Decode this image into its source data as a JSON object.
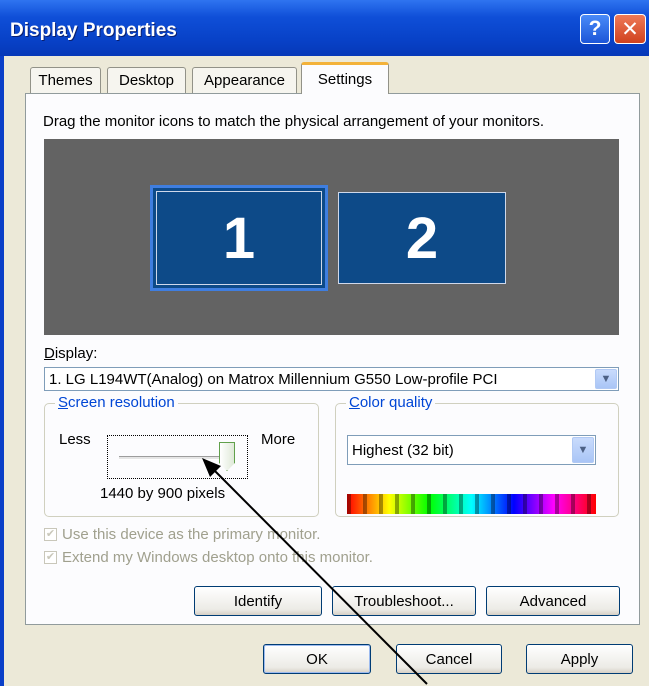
{
  "window": {
    "title": "Display Properties",
    "help_glyph": "?",
    "close_glyph": "✕"
  },
  "tabs": [
    {
      "label": "Themes",
      "active": false
    },
    {
      "label": "Desktop",
      "active": false
    },
    {
      "label": "Appearance",
      "active": false
    },
    {
      "label": "Settings",
      "active": true
    }
  ],
  "settings": {
    "instruction": "Drag the monitor icons to match the physical arrangement of your monitors.",
    "monitors": [
      {
        "number": "1",
        "selected": true
      },
      {
        "number": "2",
        "selected": false
      }
    ],
    "display_label": "Display:",
    "display_value": "1. LG L194WT(Analog) on Matrox Millennium G550 Low-profile PCI",
    "resolution": {
      "legend": "Screen resolution",
      "less_label": "Less",
      "more_label": "More",
      "value_text": "1440 by 900 pixels",
      "slider_level": 1.0
    },
    "color_quality": {
      "legend": "Color quality",
      "value": "Highest (32 bit)"
    },
    "checkbox_primary": {
      "label": "Use this device as the primary monitor.",
      "checked": true,
      "disabled": true
    },
    "checkbox_extend": {
      "label": "Extend my Windows desktop onto this monitor.",
      "checked": true,
      "disabled": true
    },
    "buttons": {
      "identify": "Identify",
      "troubleshoot": "Troubleshoot...",
      "advanced": "Advanced"
    }
  },
  "dialog_buttons": {
    "ok": "OK",
    "cancel": "Cancel",
    "apply": "Apply"
  },
  "colors": {
    "titlebar": "#0a3fc8",
    "monitor_area": "#636363",
    "monitor": "#0d4a88",
    "legend_text": "#0046d5"
  }
}
